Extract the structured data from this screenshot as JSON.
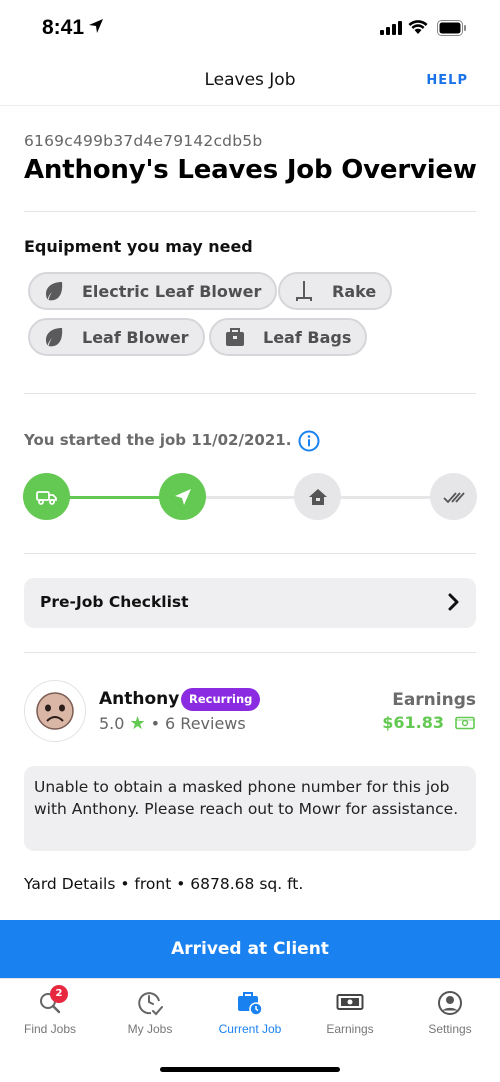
{
  "status_bar": {
    "time": "8:41"
  },
  "nav": {
    "title": "Leaves Job",
    "help": "HELP"
  },
  "job": {
    "id": "6169c499b37d4e79142cdb5b",
    "title": "Anthony's Leaves Job Overview"
  },
  "equipment": {
    "heading": "Equipment you may need",
    "items": [
      {
        "label": "Electric Leaf Blower",
        "icon": "leaf-icon"
      },
      {
        "label": "Rake",
        "icon": "rake-icon"
      },
      {
        "label": "Leaf Blower",
        "icon": "leaf-icon"
      },
      {
        "label": "Leaf Bags",
        "icon": "bag-icon"
      }
    ]
  },
  "progress": {
    "started_text": "You started the job 11/02/2021.",
    "steps": [
      {
        "icon": "truck-icon",
        "done": true
      },
      {
        "icon": "navigation-arrow-icon",
        "done": true
      },
      {
        "icon": "house-icon",
        "done": false
      },
      {
        "icon": "double-check-icon",
        "done": false
      }
    ]
  },
  "checklist": {
    "label": "Pre-Job Checklist"
  },
  "client": {
    "name": "Anthony",
    "badge": "Recurring",
    "rating": "5.0",
    "reviews": "6 Reviews",
    "earnings_label": "Earnings",
    "earnings_value": "$61.83"
  },
  "notice": "Unable to obtain a masked phone number for this job with Anthony. Please reach out to Mowr for assistance.",
  "yard_details": "Yard Details • front • 6878.68 sq. ft.",
  "cta": "Arrived at Client",
  "tabs": [
    {
      "label": "Find Jobs",
      "icon": "search-icon",
      "badge": "2"
    },
    {
      "label": "My Jobs",
      "icon": "clock-check-icon"
    },
    {
      "label": "Current Job",
      "icon": "briefcase-clock-icon",
      "active": true
    },
    {
      "label": "Earnings",
      "icon": "money-icon"
    },
    {
      "label": "Settings",
      "icon": "user-circle-icon"
    }
  ],
  "colors": {
    "accent": "#1a82f0",
    "success": "#64c952",
    "recurring": "#8a2be2",
    "badge": "#e8283f"
  }
}
